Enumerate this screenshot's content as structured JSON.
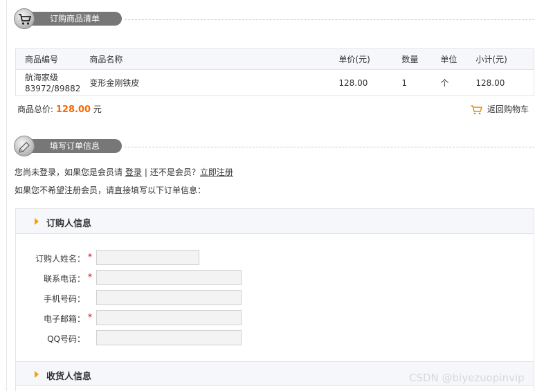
{
  "order_list": {
    "section_title": "订购商品清单",
    "columns": [
      "商品编号",
      "商品名称",
      "单价(元)",
      "数量",
      "单位",
      "小计(元)"
    ],
    "rows": [
      {
        "code_line1": "航海家级",
        "code_line2": "83972/89882",
        "name": "变形金刚铁皮",
        "unit_price": "128.00",
        "qty": "1",
        "unit": "个",
        "subtotal": "128.00"
      }
    ],
    "total_label": "商品总价:",
    "total_value": "128.00",
    "total_currency": "元",
    "back_to_cart": "返回购物车"
  },
  "order_info": {
    "section_title": "填写订单信息",
    "login_prompt_pre": "您尚未登录，如果您是会员请",
    "login_link": "登录",
    "separator": "|",
    "not_member": "还不是会员？",
    "register_link": "立即注册",
    "hint": "如果您不希望注册会员，请直接填写以下订单信息："
  },
  "buyer_form": {
    "title": "订购人信息",
    "fields": [
      {
        "label": "订购人姓名：",
        "required": "*",
        "value": ""
      },
      {
        "label": "联系电话：",
        "required": "*",
        "value": ""
      },
      {
        "label": "手机号码：",
        "required": "",
        "value": ""
      },
      {
        "label": "电子邮箱：",
        "required": "*",
        "value": ""
      },
      {
        "label": "QQ号码：",
        "required": "",
        "value": ""
      }
    ]
  },
  "receiver_form": {
    "title": "收货人信息"
  },
  "watermark": "CSDN @biyezuopinvip",
  "colors": {
    "accent_price": "#ff6600",
    "required_mark": "#d40000",
    "arrow": "#f5a100",
    "header_pill": "#777777"
  }
}
